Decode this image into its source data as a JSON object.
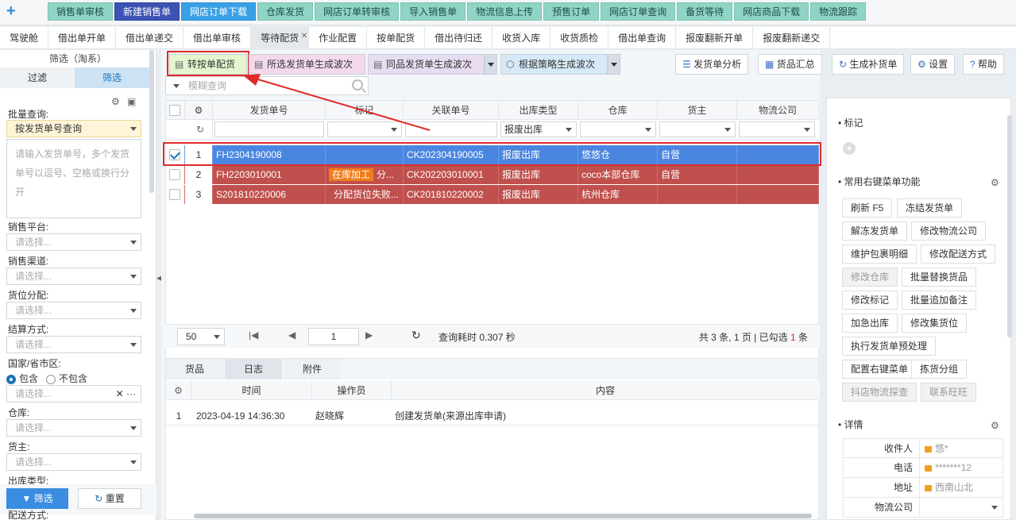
{
  "top_menu": [
    "销售单审核",
    "新建销售单",
    "网店订单下载",
    "仓库发货",
    "网店订单转审核",
    "导入销售单",
    "物流信息上传",
    "预售订单",
    "网店订单查询",
    "备货等待",
    "网店商品下载",
    "物流跟踪"
  ],
  "tabs": [
    "驾驶舱",
    "借出单开单",
    "借出单递交",
    "借出单审核",
    "等待配货",
    "作业配置",
    "按单配货",
    "借出待归还",
    "收货入库",
    "收货质检",
    "借出单查询",
    "报废翻新开单",
    "报废翻新递交"
  ],
  "left": {
    "title": "筛选（淘系）",
    "tab_filter": "过滤",
    "tab_screen": "筛选",
    "batch_label": "批量查询:",
    "batch_select": "按发货单号查询",
    "batch_placeholder": "请输入发货单号，多个发货单号以逗号、空格或换行分开",
    "platform_label": "销售平台:",
    "channel_label": "销售渠道:",
    "slot_label": "货位分配:",
    "settle_label": "结算方式:",
    "region_label": "国家/省市区:",
    "include": "包含",
    "exclude": "不包含",
    "warehouse_label": "仓库:",
    "owner_label": "货主:",
    "outtype_label": "出库类型:",
    "delivery_label": "配送方式:",
    "placeholder": "请选择...",
    "btn_filter": "筛选",
    "btn_reset": "重置"
  },
  "toolbar": {
    "convert": "转按单配货",
    "gen_selected": "所选发货单生成波次",
    "gen_same": "同品发货单生成波次",
    "gen_strategy": "根据策略生成波次",
    "analysis": "发货单分析",
    "summary": "货品汇总",
    "replenish": "生成补货单",
    "settings": "设置",
    "help": "帮助",
    "search_placeholder": "模糊查询"
  },
  "grid": {
    "columns": [
      "发货单号",
      "标记",
      "关联单号",
      "出库类型",
      "仓库",
      "货主",
      "物流公司"
    ],
    "filter_outtype": "报废出库",
    "rows": [
      {
        "num": "1",
        "order": "FH2304190008",
        "tag": "",
        "tag2": "",
        "ref": "CK202304190005",
        "type": "报废出库",
        "wh": "悠悠仓",
        "owner": "自营"
      },
      {
        "num": "2",
        "order": "FH2203010001",
        "tag": "在库加工",
        "tag2": "分...",
        "ref": "CK202203010001",
        "type": "报废出库",
        "wh": "coco本部仓库",
        "owner": "自营"
      },
      {
        "num": "3",
        "order": "S201810220006",
        "tag": "",
        "tag2": "分配货位失败...",
        "ref": "CK201810220002",
        "type": "报废出库",
        "wh": "杭州仓库",
        "owner": ""
      }
    ],
    "page_size": "50",
    "page": "1",
    "query_time": "查询耗时 0.307 秒",
    "summary_a": "共 3 条, 1 页 | 已勾选 ",
    "summary_count": "1",
    "summary_b": " 条"
  },
  "bottom": {
    "tabs": [
      "货品",
      "日志",
      "附件"
    ],
    "cols": [
      "时间",
      "操作员",
      "内容"
    ],
    "row": {
      "num": "1",
      "time": "2023-04-19 14:36:30",
      "op": "赵晓辉",
      "content": "创建发货单(来源出库申请)"
    }
  },
  "right": {
    "mark_title": "标记",
    "common_title": "常用右键菜单功能",
    "buttons": [
      "刷新 F5",
      "冻结发货单",
      "解冻发货单",
      "修改物流公司",
      "维护包裹明细",
      "修改配送方式",
      "修改仓库",
      "批量替换货品",
      "修改标记",
      "批量追加备注",
      "加急出库",
      "修改集货位",
      "执行发货单预处理",
      "配置右键菜单",
      "拣货分组",
      "抖店物流探查",
      "联系旺旺"
    ],
    "detail_title": "详情",
    "detail": [
      {
        "k": "收件人",
        "v": "悠*"
      },
      {
        "k": "电话",
        "v": "*******12"
      },
      {
        "k": "地址",
        "v": "西南山北"
      },
      {
        "k": "物流公司",
        "v": ""
      }
    ]
  }
}
